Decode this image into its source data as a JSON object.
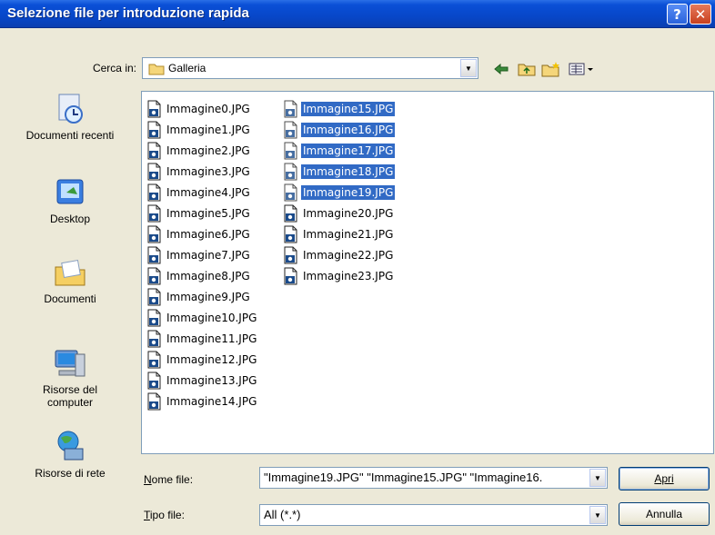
{
  "window": {
    "title": "Selezione file per introduzione rapida",
    "help_label": "?",
    "close_label": "✕"
  },
  "lookin": {
    "label": "Cerca in:",
    "value": "Galleria",
    "icons": [
      "back-arrow-icon",
      "up-one-level-icon",
      "new-folder-icon",
      "view-menu-icon"
    ]
  },
  "places": [
    {
      "label": "Documenti recenti",
      "icon": "recent-documents-icon"
    },
    {
      "label": "Desktop",
      "icon": "desktop-icon"
    },
    {
      "label": "Documenti",
      "icon": "my-documents-icon"
    },
    {
      "label": "Risorse del computer",
      "icon": "my-computer-icon"
    },
    {
      "label": "Risorse di rete",
      "icon": "network-places-icon"
    }
  ],
  "files_col1": [
    "Immagine0.JPG",
    "Immagine1.JPG",
    "Immagine2.JPG",
    "Immagine3.JPG",
    "Immagine4.JPG",
    "Immagine5.JPG",
    "Immagine6.JPG",
    "Immagine7.JPG",
    "Immagine8.JPG",
    "Immagine9.JPG",
    "Immagine10.JPG",
    "Immagine11.JPG",
    "Immagine12.JPG",
    "Immagine13.JPG",
    "Immagine14.JPG"
  ],
  "files_col2": [
    {
      "name": "Immagine15.JPG",
      "selected": true
    },
    {
      "name": "Immagine16.JPG",
      "selected": true
    },
    {
      "name": "Immagine17.JPG",
      "selected": true
    },
    {
      "name": "Immagine18.JPG",
      "selected": true
    },
    {
      "name": "Immagine19.JPG",
      "selected": true
    },
    {
      "name": "Immagine20.JPG",
      "selected": false
    },
    {
      "name": "Immagine21.JPG",
      "selected": false
    },
    {
      "name": "Immagine22.JPG",
      "selected": false
    },
    {
      "name": "Immagine23.JPG",
      "selected": false
    }
  ],
  "filename": {
    "label": "Nome file:",
    "value": "\"Immagine19.JPG\" \"Immagine15.JPG\" \"Immagine16."
  },
  "filetype": {
    "label": "Tipo file:",
    "value": "All (*.*)"
  },
  "buttons": {
    "open": "Apri",
    "cancel": "Annulla"
  },
  "colors": {
    "titlebar": "#0a4fd6",
    "selection": "#316ac5",
    "dialog_bg": "#ece9d8"
  }
}
